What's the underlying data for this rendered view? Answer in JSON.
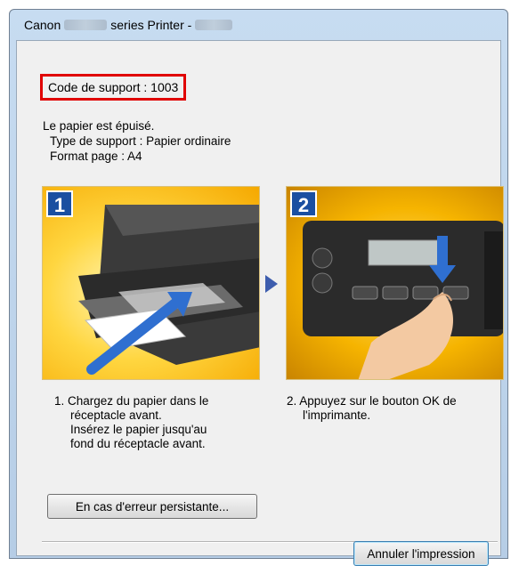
{
  "window": {
    "title_prefix": "Canon",
    "title_middle": "series Printer -"
  },
  "support_code": "Code de support : 1003",
  "message": {
    "line1": "Le papier est épuisé.",
    "line2": "Type de support : Papier ordinaire",
    "line3": "Format page : A4"
  },
  "steps": [
    {
      "number": "1",
      "caption_first": "Chargez du papier dans le",
      "caption_lines": [
        "réceptacle avant.",
        "Insérez le papier jusqu'au",
        "fond du réceptacle avant."
      ],
      "caption_prefix": "1."
    },
    {
      "number": "2",
      "caption_first": "Appuyez sur le bouton OK de",
      "caption_lines": [
        "l'imprimante."
      ],
      "caption_prefix": "2."
    }
  ],
  "buttons": {
    "persist": "En cas d'erreur persistante...",
    "cancel": "Annuler l'impression"
  },
  "colors": {
    "highlight_border": "#e00000",
    "step_badge": "#1a4fa1"
  }
}
